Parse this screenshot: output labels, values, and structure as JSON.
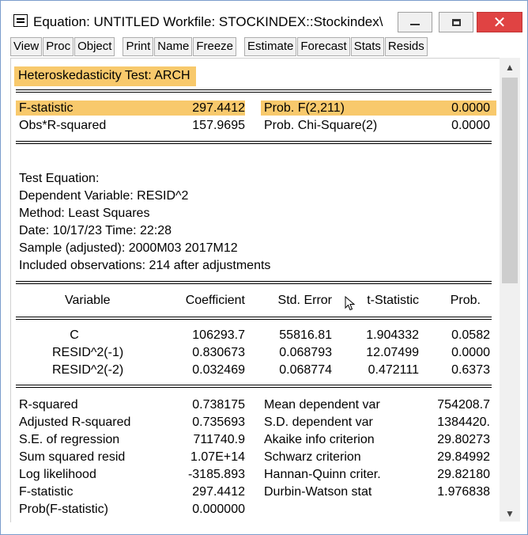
{
  "window": {
    "title": "Equation: UNTITLED   Workfile: STOCKINDEX::Stockindex\\",
    "close_glyph": "✕"
  },
  "toolbar": {
    "group1": [
      "View",
      "Proc",
      "Object"
    ],
    "group2": [
      "Print",
      "Name",
      "Freeze"
    ],
    "group3": [
      "Estimate",
      "Forecast",
      "Stats",
      "Resids"
    ]
  },
  "test_title": "Heteroskedasticity Test: ARCH",
  "test_stats": {
    "f_label": "F-statistic",
    "f_value": "297.4412",
    "f_prob_label": "Prob. F(2,211)",
    "f_prob_value": "0.0000",
    "obs_label": "Obs*R-squared",
    "obs_value": "157.9695",
    "chi_label": "Prob. Chi-Square(2)",
    "chi_value": "0.0000"
  },
  "test_equation": {
    "heading": "Test Equation:",
    "dependent": "Dependent Variable: RESID^2",
    "method": "Method: Least Squares",
    "date": "Date: 10/17/23   Time: 22:28",
    "sample": "Sample (adjusted): 2000M03 2017M12",
    "observations": "Included observations: 214 after adjustments"
  },
  "coef_table": {
    "headers": [
      "Variable",
      "Coefficient",
      "Std. Error",
      "t-Statistic",
      "Prob."
    ],
    "rows": [
      [
        "C",
        "106293.7",
        "55816.81",
        "1.904332",
        "0.0582"
      ],
      [
        "RESID^2(-1)",
        "0.830673",
        "0.068793",
        "12.07499",
        "0.0000"
      ],
      [
        "RESID^2(-2)",
        "0.032469",
        "0.068774",
        "0.472111",
        "0.6373"
      ]
    ]
  },
  "summary": {
    "left": [
      [
        "R-squared",
        "0.738175"
      ],
      [
        "Adjusted R-squared",
        "0.735693"
      ],
      [
        "S.E. of regression",
        "711740.9"
      ],
      [
        "Sum squared resid",
        "1.07E+14"
      ],
      [
        "Log likelihood",
        "-3185.893"
      ],
      [
        "F-statistic",
        "297.4412"
      ],
      [
        "Prob(F-statistic)",
        "0.000000"
      ]
    ],
    "right": [
      [
        "Mean dependent var",
        "754208.7"
      ],
      [
        "S.D. dependent var",
        "1384420."
      ],
      [
        "Akaike info criterion",
        "29.80273"
      ],
      [
        "Schwarz criterion",
        "29.84992"
      ],
      [
        "Hannan-Quinn criter.",
        "29.82180"
      ],
      [
        "Durbin-Watson stat",
        "1.976838"
      ]
    ]
  },
  "colors": {
    "highlight": "#f8c96c",
    "close_button": "#e04343"
  },
  "icons": [
    "system-menu-icon",
    "minimize-icon",
    "maximize-icon",
    "close-icon",
    "scroll-up-icon",
    "scroll-down-icon",
    "mouse-cursor-icon"
  ]
}
